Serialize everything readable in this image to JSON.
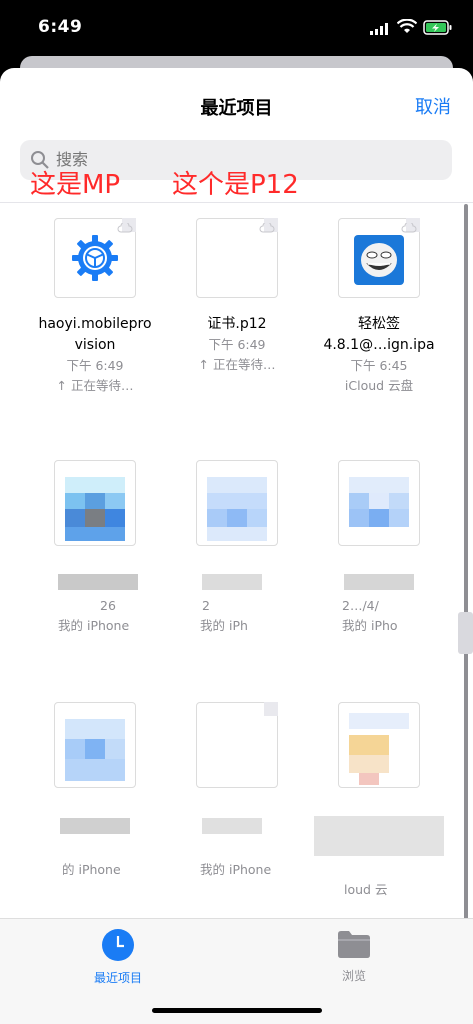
{
  "status": {
    "time": "6:49"
  },
  "nav": {
    "title": "最近项目",
    "cancel": "取消"
  },
  "search": {
    "placeholder": "搜索"
  },
  "annotations": {
    "mp": "这是MP",
    "p12": "这个是P12"
  },
  "files": [
    {
      "name_line1": "haoyi.mobilepro",
      "name_line2": "vision",
      "date": "下午 6:49",
      "status": "↑ 正在等待…"
    },
    {
      "name_line1": "证书.p12",
      "name_line2": "",
      "date": "下午 6:49",
      "status": "↑ 正在等待…"
    },
    {
      "name_line1": "轻松签",
      "name_line2": "4.8.1@…ign.ipa",
      "date": "下午 6:45",
      "status": "iCloud 云盘"
    }
  ],
  "blurred": {
    "row2": [
      {
        "date": "26",
        "location": "我的 iPhone"
      },
      {
        "date": "2",
        "location": "我的 iPh"
      },
      {
        "date": "2…/4/",
        "location": "我的 iPho"
      }
    ],
    "row3": [
      {
        "location": "的 iPhone"
      },
      {
        "location": "我的 iPhone"
      },
      {
        "location": "loud 云"
      }
    ]
  },
  "tabs": [
    {
      "label": "最近项目",
      "color": "#1a7cf5"
    },
    {
      "label": "浏览",
      "color": "#8e8e93"
    }
  ],
  "colors": {
    "accent": "#1a7cf5",
    "annotation": "#ff2a2a"
  }
}
